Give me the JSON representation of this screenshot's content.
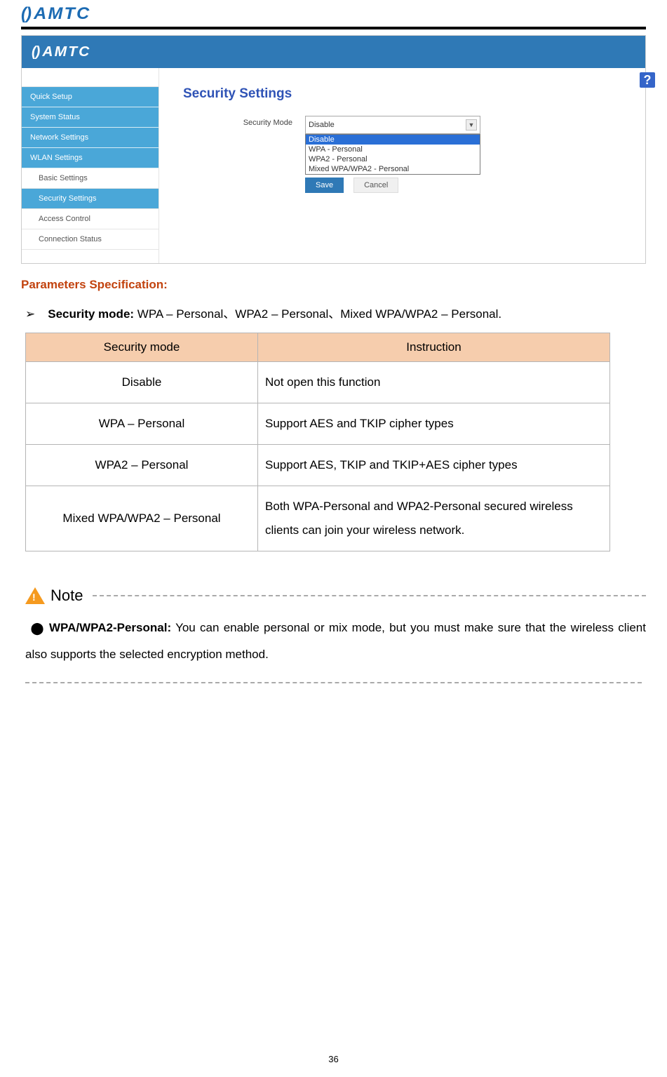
{
  "header_logo_mark": "()",
  "header_logo_text": "AMTC",
  "ui": {
    "topbar_logo_mark": "()",
    "topbar_logo_text": "AMTC",
    "help_icon": "?",
    "sidebar": {
      "items": [
        "Quick Setup",
        "System Status",
        "Network Settings",
        "WLAN Settings"
      ],
      "children": [
        "Basic Settings",
        "Security Settings",
        "Access Control",
        "Connection Status"
      ]
    },
    "content_title": "Security Settings",
    "form_label": "Security Mode",
    "select_value": "Disable",
    "dropdown_options": [
      "Disable",
      "WPA - Personal",
      "WPA2 - Personal",
      "Mixed WPA/WPA2 - Personal"
    ],
    "btn_save": "Save",
    "btn_cancel": "Cancel"
  },
  "params_heading": "Parameters Specification:",
  "bullet_symbol": "➢",
  "bullet_label": "Security mode:",
  "bullet_text": " WPA – Personal、WPA2 – Personal、Mixed WPA/WPA2 – Personal.",
  "table": {
    "headers": [
      "Security mode",
      "Instruction"
    ],
    "rows": [
      {
        "mode": "Disable",
        "instruction": "Not open this function"
      },
      {
        "mode": "WPA – Personal",
        "instruction": "Support AES and TKIP cipher types"
      },
      {
        "mode": "WPA2 – Personal",
        "instruction": "Support AES, TKIP and TKIP+AES cipher types"
      },
      {
        "mode": "Mixed WPA/WPA2 – Personal",
        "instruction": "Both WPA-Personal and WPA2-Personal secured wireless clients can join your wireless network."
      }
    ]
  },
  "note_label": "Note",
  "note_bullet_label": "WPA/WPA2-Personal:",
  "note_bullet_text": " You can enable personal or mix mode, but you must make sure that the wireless client also supports the selected encryption method.",
  "page_number": "36"
}
